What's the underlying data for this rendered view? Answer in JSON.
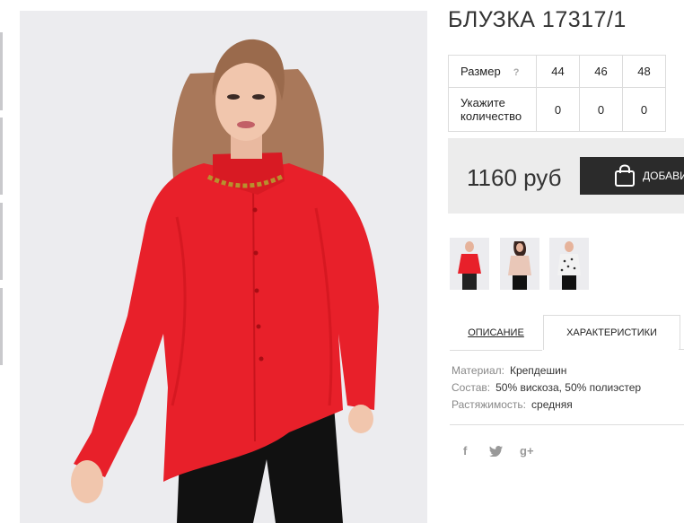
{
  "product": {
    "title": "БЛУЗКА 17317/1"
  },
  "size_table": {
    "size_label": "Размер",
    "help_icon": "?",
    "sizes": [
      "44",
      "46",
      "48"
    ],
    "qty_label_line1": "Укажите",
    "qty_label_line2": "количество",
    "quantities": [
      "0",
      "0",
      "0"
    ]
  },
  "purchase": {
    "price": "1160 руб",
    "add_button_label": "ДОБАВИТЬ В КОРЗИНУ",
    "button_icon": "shopping-bag-icon"
  },
  "tabs": {
    "description": "ОПИСАНИЕ",
    "characteristics": "ХАРАКТЕРИСТИКИ",
    "active": "characteristics"
  },
  "specs": [
    {
      "key": "Материал:",
      "value": "Крепдешин"
    },
    {
      "key": "Состав:",
      "value": "50% вискоза, 50% полиэстер"
    },
    {
      "key": "Растяжимость:",
      "value": "средняя"
    }
  ],
  "social": {
    "facebook": "f",
    "twitter_icon": "twitter-icon",
    "googleplus": "g+"
  },
  "colors": {
    "blouse_red": "#e8202a",
    "button_dark": "#2b2b2b",
    "panel_gray": "#ececec"
  }
}
